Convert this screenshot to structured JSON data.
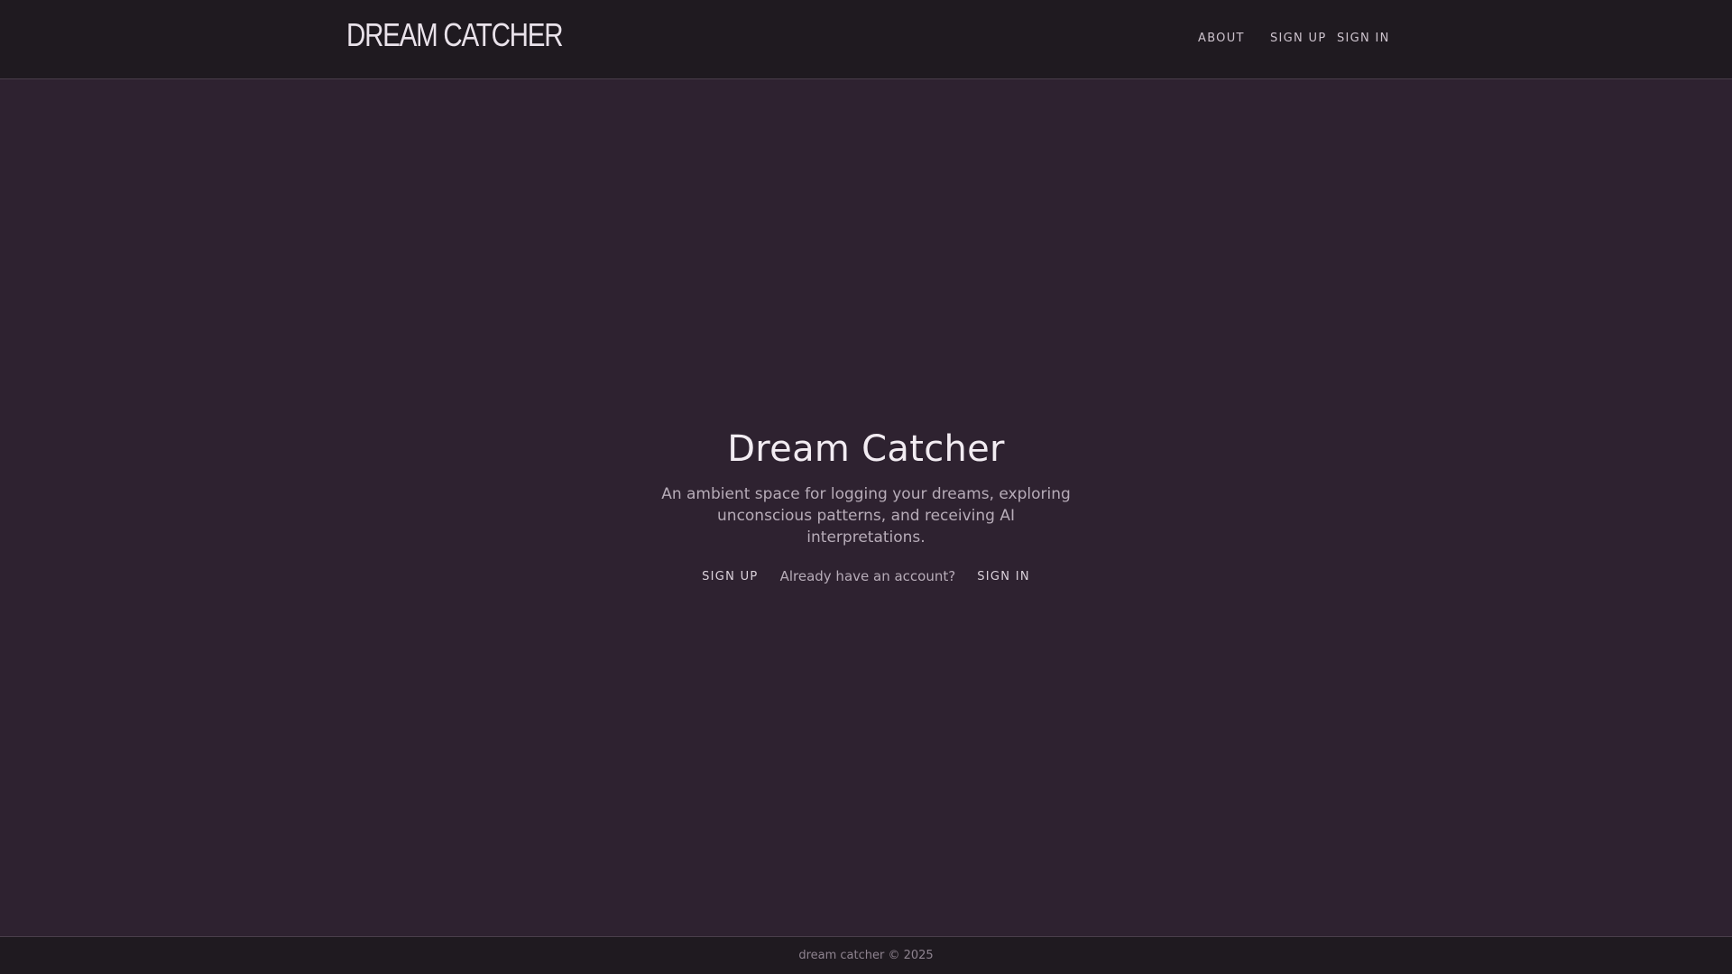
{
  "header": {
    "logo": "DREAM CATCHER",
    "nav": {
      "about": "ABOUT",
      "sign_up": "SIGN UP",
      "sign_in": "SIGN IN"
    }
  },
  "hero": {
    "title": "Dream Catcher",
    "description": "An ambient space for logging your dreams, exploring unconscious patterns, and receiving AI interpretations.",
    "sign_up": "SIGN UP",
    "account_prompt": "Already have an account?",
    "sign_in": "SIGN IN"
  },
  "footer": {
    "text": "dream catcher © 2025"
  },
  "colors": {
    "background": "#2e2230",
    "header_background": "#1f1a20",
    "text_primary": "#f2ecf2",
    "text_muted": "#b7acb8"
  }
}
